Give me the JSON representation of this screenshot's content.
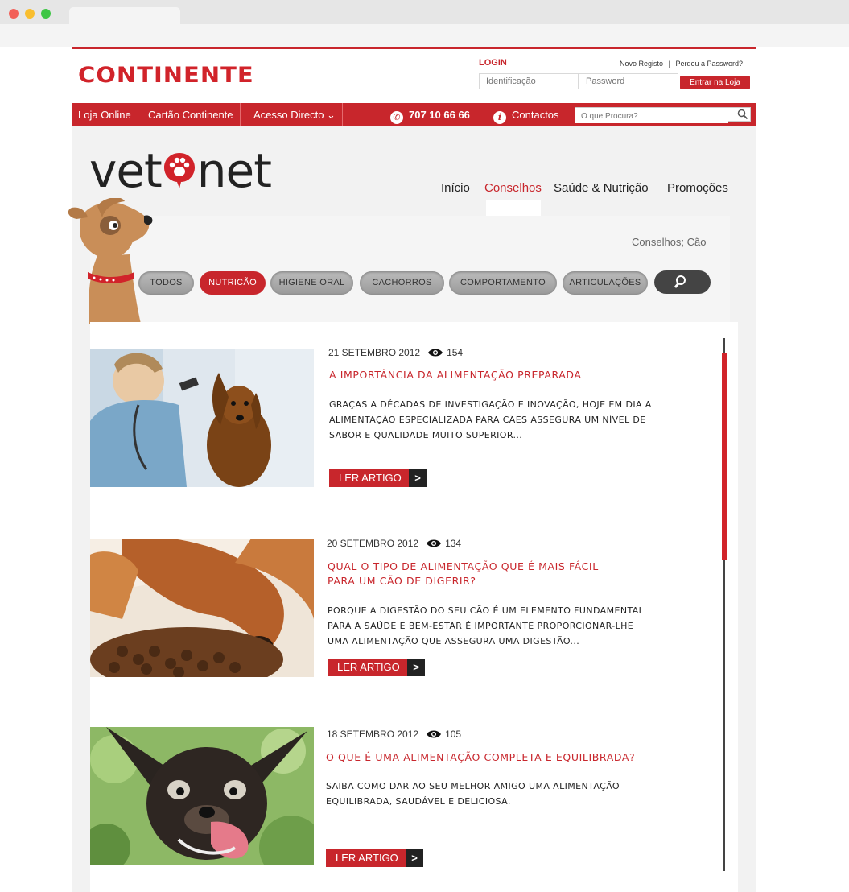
{
  "header": {
    "brand": "CONTINENTE",
    "login_title": "LOGIN",
    "register_link": "Novo Registo",
    "separator": "|",
    "forgot_link": "Perdeu a Password?",
    "id_placeholder": "Identificação",
    "password_placeholder": "Password",
    "login_button": "Entrar na Loja"
  },
  "topnav": {
    "items": [
      "Loja Online",
      "Cartão Continente",
      "Acesso Directo ⌄"
    ],
    "phone": "707 10 66 66",
    "contacts": "Contactos",
    "search_placeholder": "O que Procura?"
  },
  "vetonet": {
    "logo_left": "vet",
    "logo_right": "net",
    "nav": [
      "Início",
      "Conselhos",
      "Saúde & Nutrição",
      "Promoções"
    ],
    "active_nav": "Conselhos",
    "breadcrumb": "Conselhos; Cão"
  },
  "filters": {
    "items": [
      "TODOS",
      "NUTRICÃO",
      "HIGIENE ORAL",
      "CACHORROS",
      "COMPORTAMENTO",
      "ARTICULAÇÕES"
    ],
    "active": "NUTRICÃO"
  },
  "articles": [
    {
      "date": "21 SETEMBRO 2012",
      "views": "154",
      "title_lines": [
        "A IMPORTÂNCIA DA ALIMENTAÇÃO PREPARADA"
      ],
      "body_lines": [
        "GRAÇAS A DÉCADAS DE INVESTIGAÇÃO E INOVAÇÃO, HOJE EM DIA A",
        "ALIMENTAÇÃO ESPECIALIZADA PARA CÃES ASSEGURA UM NÍVEL DE",
        "SABOR E QUALIDADE MUITO SUPERIOR..."
      ],
      "button": "LER ARTIGO",
      "arrow": ">"
    },
    {
      "date": "20 SETEMBRO 2012",
      "views": "134",
      "title_lines": [
        "QUAL O TIPO DE ALIMENTAÇÃO QUE É MAIS FÁCIL",
        "PARA UM CÃO DE DIGERIR?"
      ],
      "body_lines": [
        "PORQUE A DIGESTÃO DO SEU CÃO É UM ELEMENTO FUNDAMENTAL",
        "PARA A SAÚDE E BEM-ESTAR É IMPORTANTE PROPORCIONAR-LHE",
        "UMA ALIMENTAÇÃO QUE ASSEGURA UMA DIGESTÃO..."
      ],
      "button": "LER ARTIGO",
      "arrow": ">"
    },
    {
      "date": "18 SETEMBRO 2012",
      "views": "105",
      "title_lines": [
        "O QUE É UMA ALIMENTAÇÃO COMPLETA E EQUILIBRADA?"
      ],
      "body_lines": [
        "SAIBA COMO DAR AO SEU MELHOR AMIGO UMA ALIMENTAÇÃO",
        "EQUILIBRADA, SAUDÁVEL E DELICIOSA."
      ],
      "button": "LER ARTIGO",
      "arrow": ">"
    }
  ],
  "colors": {
    "brand_red": "#c8262c",
    "dark": "#222222",
    "pill_grey": "#a8a8a8"
  },
  "icons": {
    "phone": "phone-icon",
    "info": "info-icon",
    "eye": "eye-icon",
    "search": "search-icon",
    "paw": "paw-icon"
  }
}
